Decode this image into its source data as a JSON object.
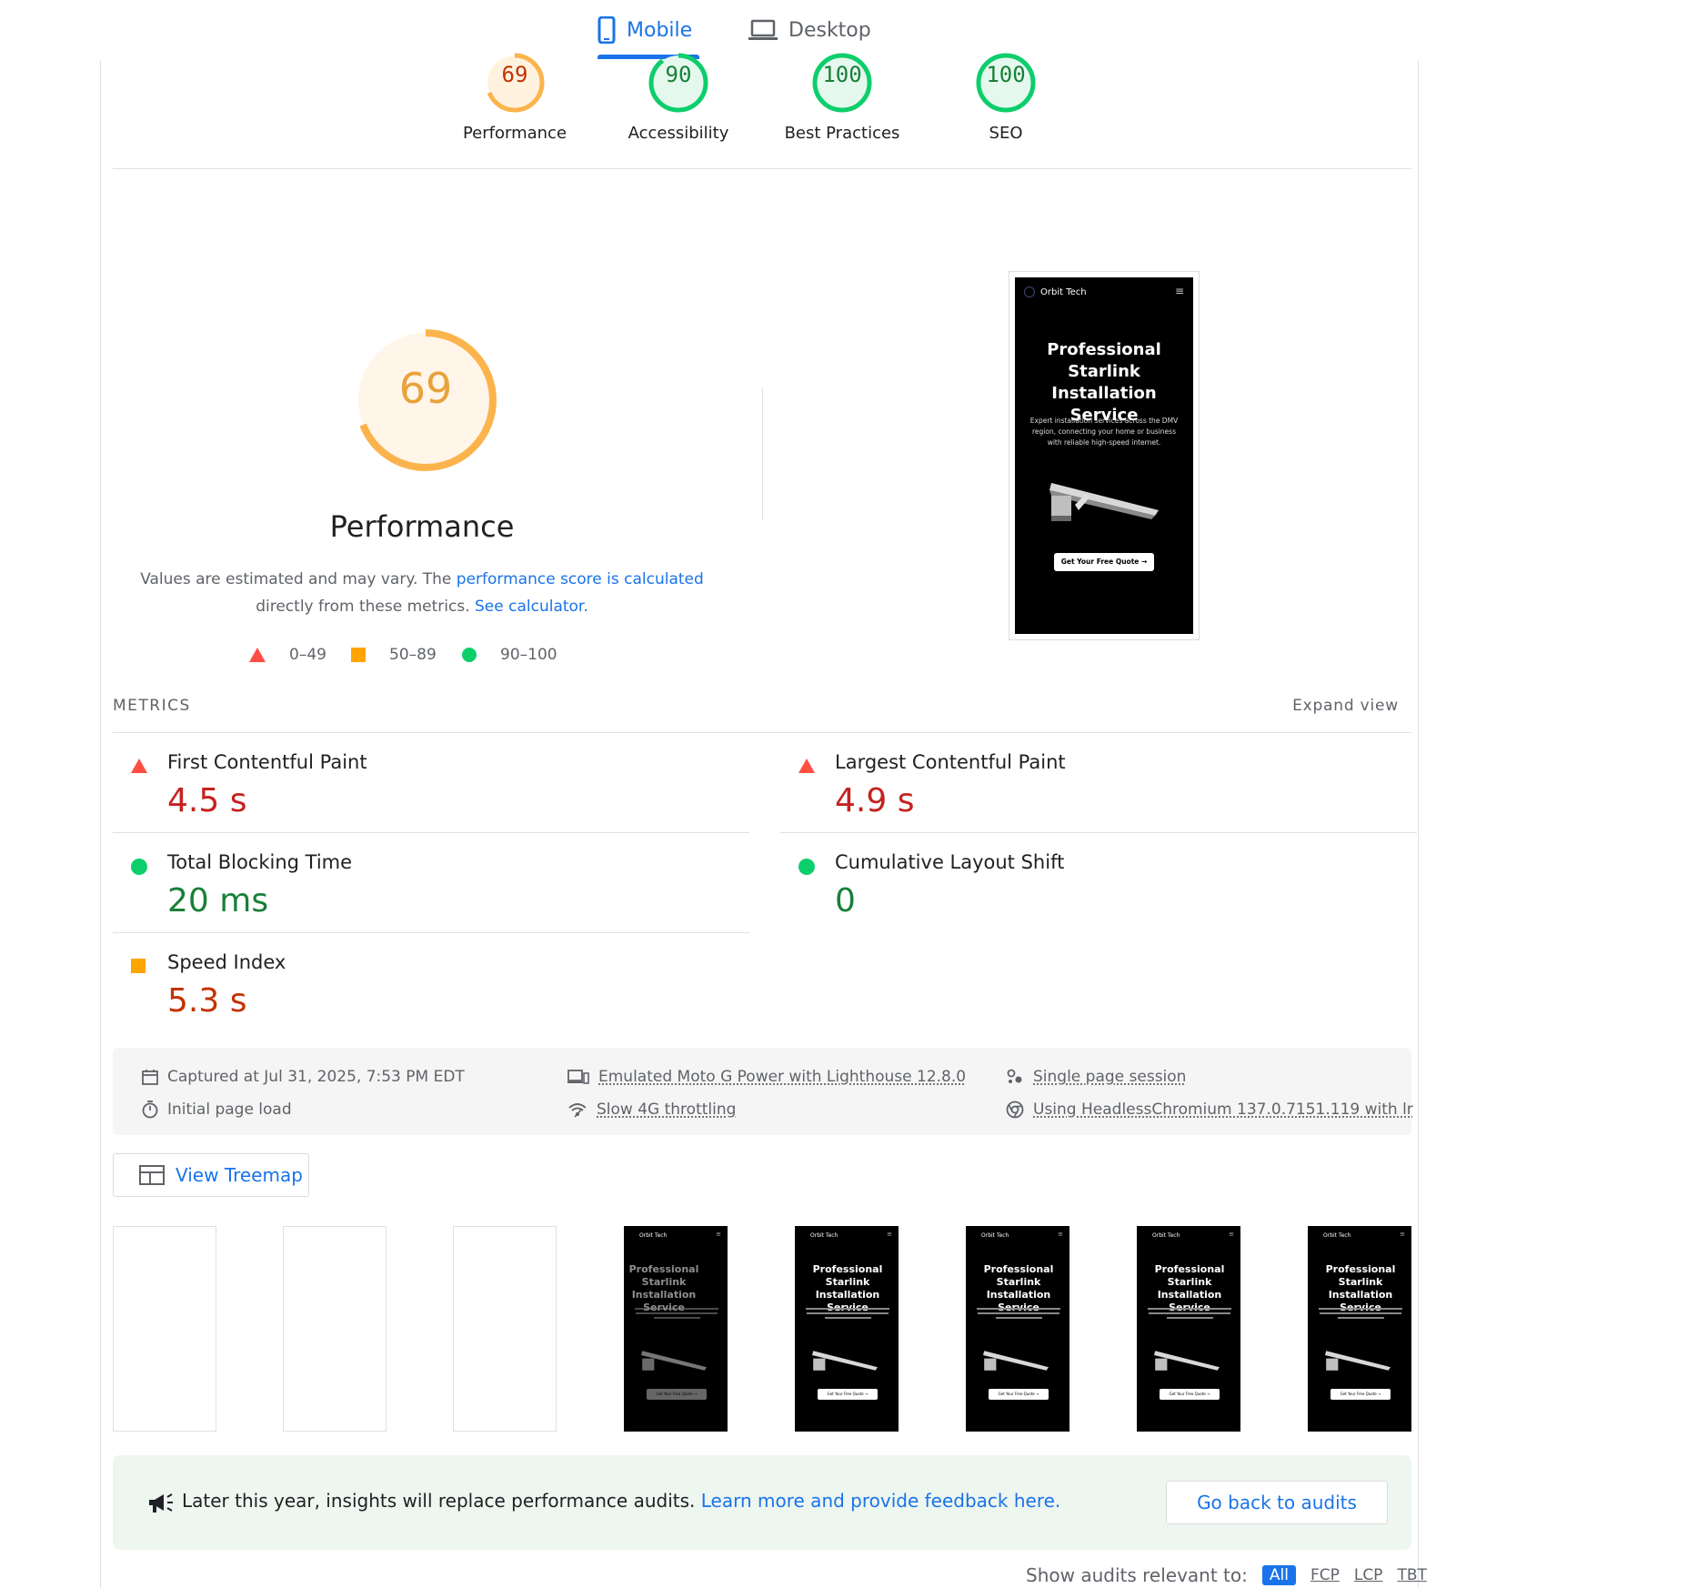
{
  "tabs": {
    "mobile": "Mobile",
    "desktop": "Desktop",
    "active": "mobile"
  },
  "categories": [
    {
      "label": "Performance",
      "score": "69",
      "value": 69,
      "color": "#fbb44c"
    },
    {
      "label": "Accessibility",
      "score": "90",
      "value": 90,
      "color": "#0cce6b"
    },
    {
      "label": "Best Practices",
      "score": "100",
      "value": 100,
      "color": "#0cce6b"
    },
    {
      "label": "SEO",
      "score": "100",
      "value": 100,
      "color": "#0cce6b"
    }
  ],
  "performance": {
    "score": "69",
    "value": 69,
    "title": "Performance",
    "desc_prefix": "Values are estimated and may vary. The ",
    "desc_link1": "performance score is calculated",
    "desc_middle": " directly from these metrics. ",
    "desc_link2": "See calculator.",
    "legend": [
      "0–49",
      "50–89",
      "90–100"
    ]
  },
  "preview": {
    "brand": "Orbit Tech",
    "menu": "≡",
    "hero": "Professional Starlink Installation Service",
    "sub": "Expert installation services across the DMV region, connecting your home or business with reliable high-speed internet.",
    "cta": "Get Your Free Quote →"
  },
  "metrics": {
    "title": "METRICS",
    "expand": "Expand view",
    "items": [
      {
        "name": "First Contentful Paint",
        "value": "4.5 s",
        "rating": "fail"
      },
      {
        "name": "Largest Contentful Paint",
        "value": "4.9 s",
        "rating": "fail"
      },
      {
        "name": "Total Blocking Time",
        "value": "20 ms",
        "rating": "pass"
      },
      {
        "name": "Cumulative Layout Shift",
        "value": "0",
        "rating": "pass"
      },
      {
        "name": "Speed Index",
        "value": "5.3 s",
        "rating": "average"
      }
    ]
  },
  "runtime": {
    "captured": "Captured at Jul 31, 2025, 7:53 PM EDT",
    "load": "Initial page load",
    "device": "Emulated Moto G Power with Lighthouse 12.8.0",
    "throttling": "Slow 4G throttling",
    "session": "Single page session",
    "browser": "Using HeadlessChromium 137.0.7151.119 with lr"
  },
  "treemap": "View Treemap",
  "filmstrip": {
    "brand": "Orbit Tech",
    "menu": "≡",
    "title": "Professional Starlink Installation Service",
    "cta": "Get Your Free Quote →"
  },
  "banner": {
    "text": "Later this year, insights will replace performance audits. ",
    "link": "Learn more and provide feedback here.",
    "button": "Go back to audits"
  },
  "filter": {
    "label": "Show audits relevant to:",
    "chips": [
      "All",
      "FCP",
      "LCP",
      "TBT"
    ],
    "active": "All"
  }
}
